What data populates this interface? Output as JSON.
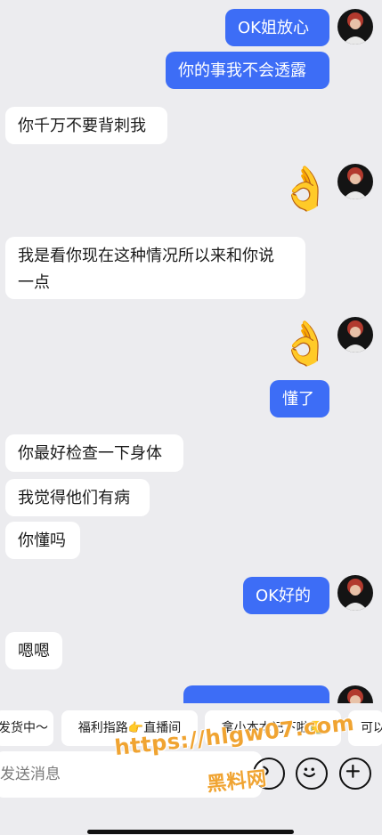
{
  "messages": [
    {
      "side": "out",
      "text": "OK姐放心"
    },
    {
      "side": "out",
      "text": "你的事我不会透露"
    },
    {
      "side": "in",
      "text": "你千万不要背刺我"
    },
    {
      "side": "out",
      "emoji": "👌"
    },
    {
      "side": "in",
      "lines": [
        "我是看你现在这种情况所以来和你说",
        "一点"
      ]
    },
    {
      "side": "out",
      "emoji": "👌"
    },
    {
      "side": "out",
      "text": "懂了"
    },
    {
      "side": "in",
      "text": "你最好检查一下身体"
    },
    {
      "side": "in",
      "text": "我觉得他们有病"
    },
    {
      "side": "in",
      "text": "你懂吗"
    },
    {
      "side": "out",
      "text": "OK好的"
    },
    {
      "side": "in",
      "text": "嗯嗯"
    }
  ],
  "quick_replies": [
    "发货中～",
    "福利指路👉直播间",
    "拿小本本记下啦📒",
    "可以"
  ],
  "input": {
    "placeholder": "发送消息"
  },
  "watermark": {
    "line1": "https://hlgw07.com",
    "line2": "黑料网"
  },
  "colors": {
    "out_bubble": "#3d6df6",
    "in_bubble": "#ffffff",
    "background": "#ececef",
    "watermark": "#f0a432"
  }
}
